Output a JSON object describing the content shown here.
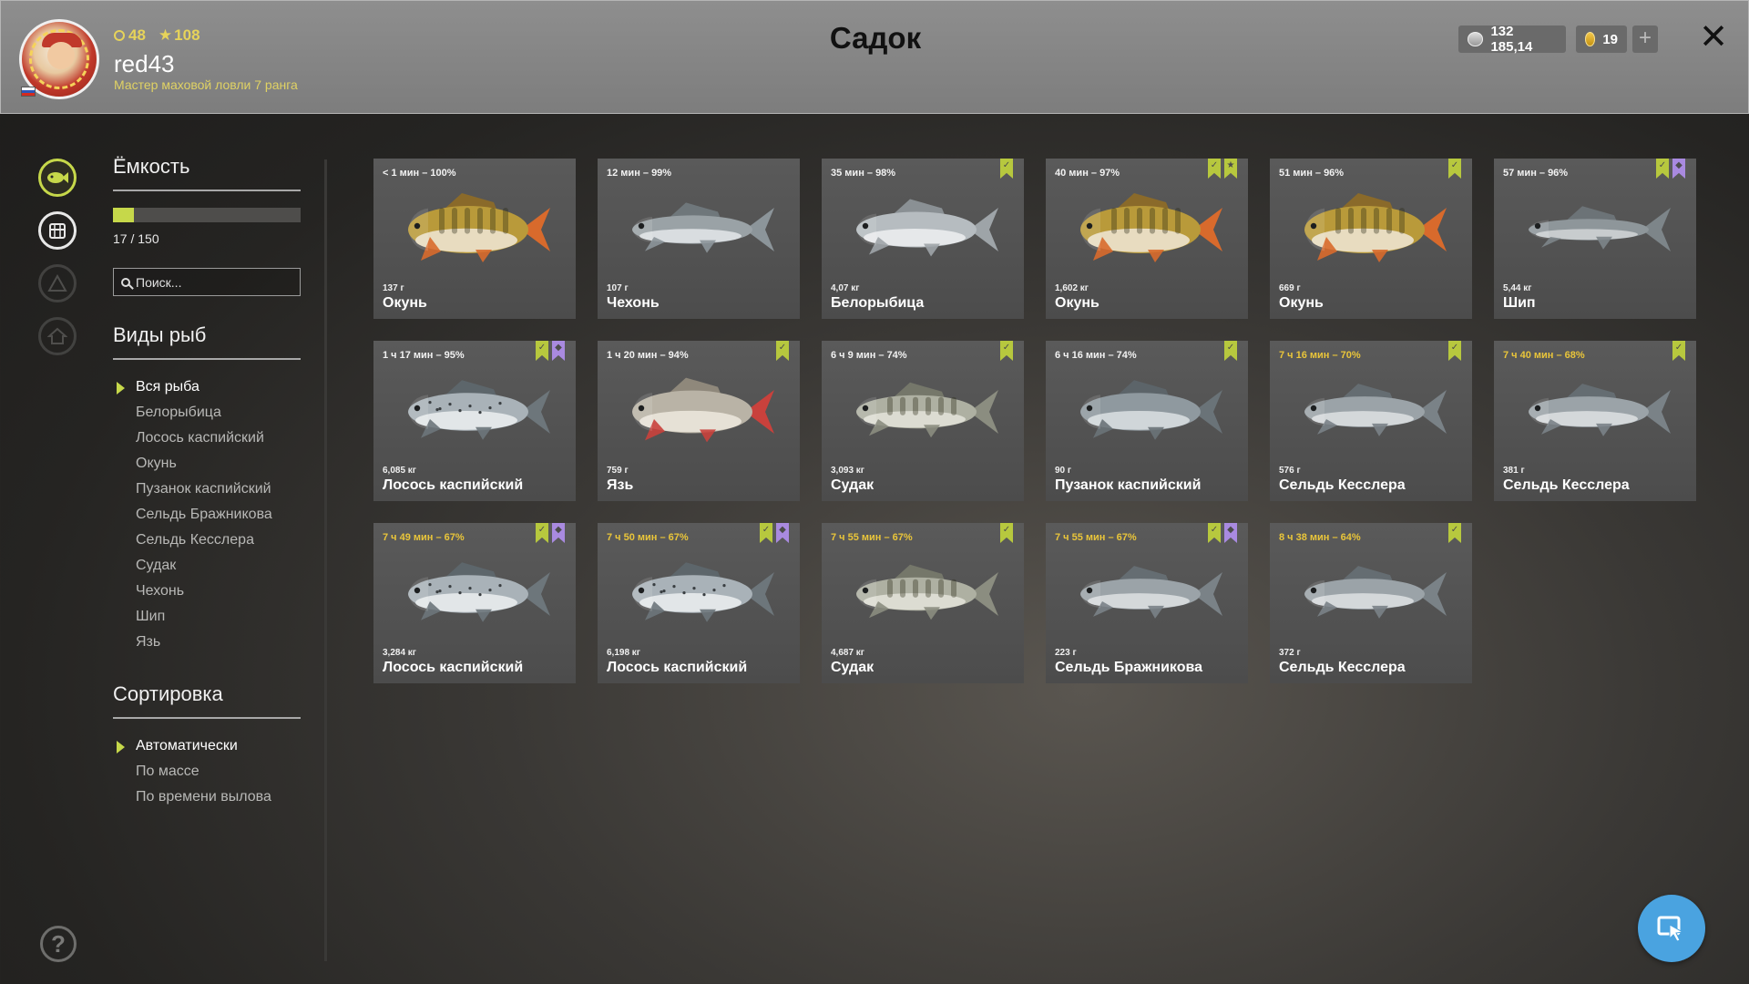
{
  "header": {
    "level": "48",
    "stars": "108",
    "username": "red43",
    "rank": "Мастер маховой ловли 7 ранга",
    "title": "Садок",
    "silver": "132 185,14",
    "gold": "19",
    "plus_label": "+",
    "close_label": "✕"
  },
  "sidebar": {
    "capacity_title": "Ёмкость",
    "capacity_used": 17,
    "capacity_max": 150,
    "capacity_text": "17 / 150",
    "search_placeholder": "Поиск...",
    "species_title": "Виды рыб",
    "species": [
      "Вся рыба",
      "Белорыбица",
      "Лосось каспийский",
      "Окунь",
      "Пузанок каспийский",
      "Сельдь Бражникова",
      "Сельдь Кесслера",
      "Судак",
      "Чехонь",
      "Шип",
      "Язь"
    ],
    "species_selected": 0,
    "sort_title": "Сортировка",
    "sort_options": [
      "Автоматически",
      "По массе",
      "По времени вылова"
    ],
    "sort_selected": 0,
    "help_label": "?"
  },
  "colors": {
    "accent_green": "#c6d84a",
    "warn_time": "#e9c53a",
    "mark_purple": "#a98ae0",
    "cursor_button": "#4aa3e0"
  },
  "fish": [
    {
      "time": "< 1 мин – 100%",
      "weight": "137 г",
      "name": "Окунь",
      "type": "perch",
      "warn": false,
      "marks": []
    },
    {
      "time": "12 мин – 99%",
      "weight": "107 г",
      "name": "Чехонь",
      "type": "sabre",
      "warn": false,
      "marks": []
    },
    {
      "time": "35 мин – 98%",
      "weight": "4,07 кг",
      "name": "Белорыбица",
      "type": "whitefish",
      "warn": false,
      "marks": [
        "green"
      ]
    },
    {
      "time": "40 мин – 97%",
      "weight": "1,602 кг",
      "name": "Окунь",
      "type": "perch",
      "warn": false,
      "marks": [
        "green",
        "green-star"
      ]
    },
    {
      "time": "51 мин – 96%",
      "weight": "669 г",
      "name": "Окунь",
      "type": "perch",
      "warn": false,
      "marks": [
        "green"
      ]
    },
    {
      "time": "57 мин – 96%",
      "weight": "5,44 кг",
      "name": "Шип",
      "type": "sturgeon",
      "warn": false,
      "marks": [
        "green",
        "purple"
      ]
    },
    {
      "time": "1 ч 17 мин – 95%",
      "weight": "6,085 кг",
      "name": "Лосось каспийский",
      "type": "salmon",
      "warn": false,
      "marks": [
        "green",
        "purple"
      ]
    },
    {
      "time": "1 ч 20 мин – 94%",
      "weight": "759 г",
      "name": "Язь",
      "type": "ide",
      "warn": false,
      "marks": [
        "green"
      ]
    },
    {
      "time": "6 ч 9 мин – 74%",
      "weight": "3,093 кг",
      "name": "Судак",
      "type": "zander",
      "warn": false,
      "marks": [
        "green"
      ]
    },
    {
      "time": "6 ч 16 мин – 74%",
      "weight": "90 г",
      "name": "Пузанок каспийский",
      "type": "shad",
      "warn": false,
      "marks": [
        "green"
      ]
    },
    {
      "time": "7 ч 16 мин – 70%",
      "weight": "576 г",
      "name": "Сельдь Кесслера",
      "type": "herring",
      "warn": true,
      "marks": [
        "green"
      ]
    },
    {
      "time": "7 ч 40 мин – 68%",
      "weight": "381 г",
      "name": "Сельдь Кесслера",
      "type": "herring",
      "warn": true,
      "marks": [
        "green"
      ]
    },
    {
      "time": "7 ч 49 мин – 67%",
      "weight": "3,284 кг",
      "name": "Лосось каспийский",
      "type": "salmon",
      "warn": true,
      "marks": [
        "green",
        "purple"
      ]
    },
    {
      "time": "7 ч 50 мин – 67%",
      "weight": "6,198 кг",
      "name": "Лосось каспийский",
      "type": "salmon",
      "warn": true,
      "marks": [
        "green",
        "purple"
      ]
    },
    {
      "time": "7 ч 55 мин – 67%",
      "weight": "4,687 кг",
      "name": "Судак",
      "type": "zander",
      "warn": true,
      "marks": [
        "green"
      ]
    },
    {
      "time": "7 ч 55 мин – 67%",
      "weight": "223 г",
      "name": "Сельдь Бражникова",
      "type": "herring",
      "warn": true,
      "marks": [
        "green",
        "purple"
      ]
    },
    {
      "time": "8 ч 38 мин – 64%",
      "weight": "372 г",
      "name": "Сельдь Кесслера",
      "type": "herring",
      "warn": true,
      "marks": [
        "green"
      ]
    }
  ]
}
